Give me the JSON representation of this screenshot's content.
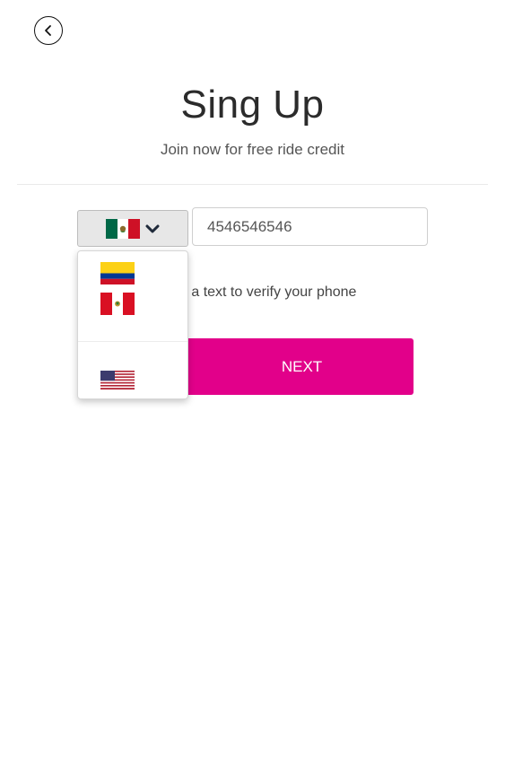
{
  "header": {
    "title": "Sing Up",
    "subtitle": "Join now for free ride credit"
  },
  "country_select": {
    "selected": "Mexico",
    "selected_icon": "mexico-flag-icon",
    "toggle_icon": "chevron-down-icon"
  },
  "phone": {
    "value": "4546546546"
  },
  "helper_text": "d a text to verify your phone",
  "next_label": "NEXT",
  "dropdown": {
    "options": [
      {
        "country": "Colombia",
        "icon": "colombia-flag-icon"
      },
      {
        "country": "Peru",
        "icon": "peru-flag-icon"
      },
      {
        "country": "United States",
        "icon": "usa-flag-icon"
      }
    ]
  },
  "colors": {
    "accent": "#e2008a",
    "select_bg": "#e7e7e7"
  }
}
